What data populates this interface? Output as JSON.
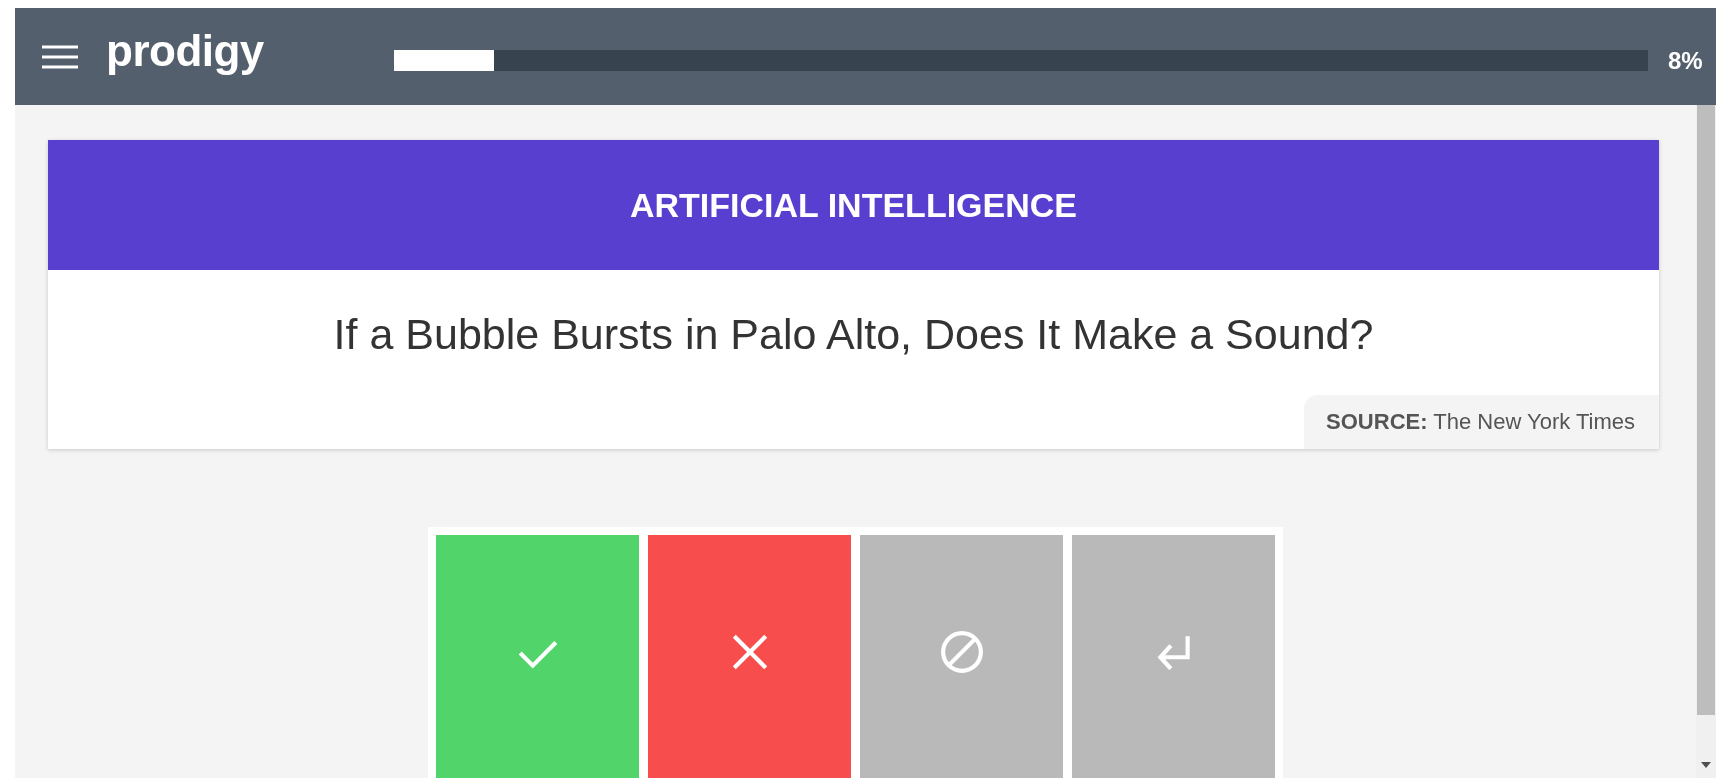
{
  "header": {
    "app_name": "prodigy",
    "progress": {
      "level": 0.08,
      "reading": "8%"
    }
  },
  "card": {
    "label": "ARTIFICIAL INTELLIGENCE",
    "text": "If a Bubble Bursts in Palo Alto, Does It Make a Sound?",
    "meta": "**SOURCE:** The New York Times"
  },
  "buttons": [
    {
      "kind": "accept"
    },
    {
      "kind": "reject"
    },
    {
      "kind": "ignore"
    },
    {
      "kind": "undo"
    }
  ]
}
